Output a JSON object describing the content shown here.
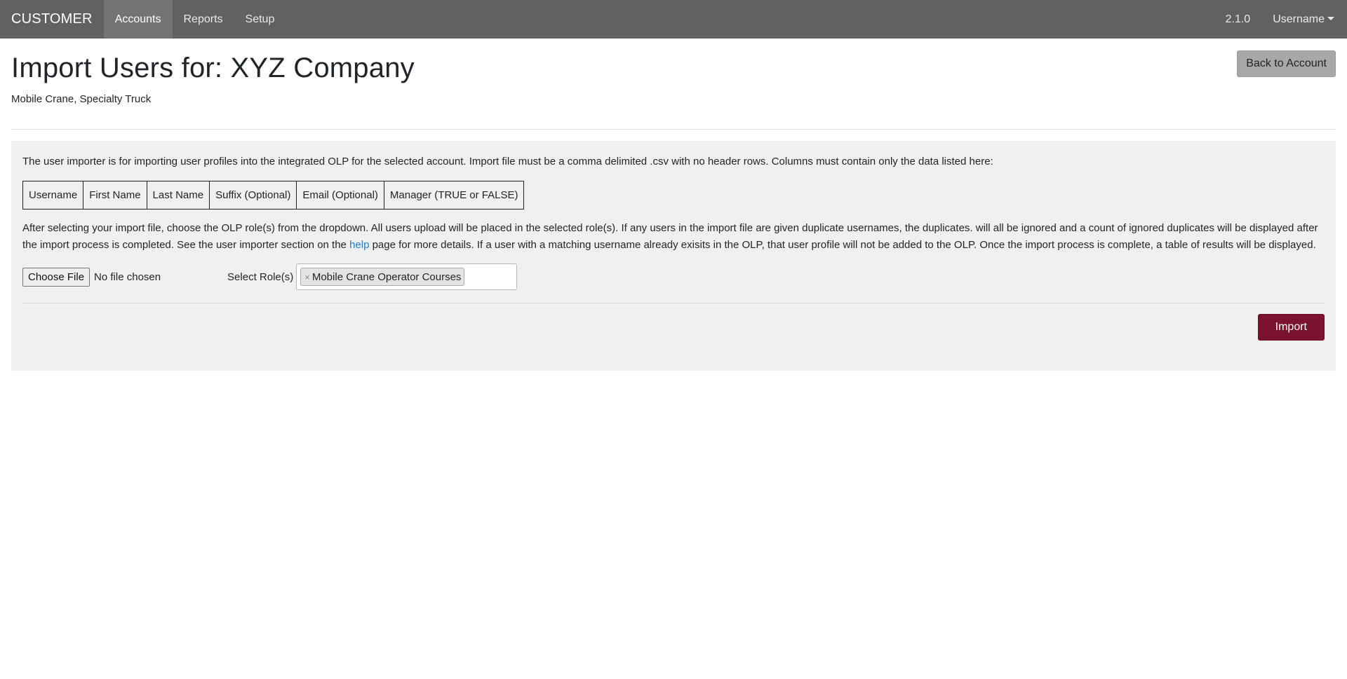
{
  "navbar": {
    "brand": "CUSTOMER",
    "items": [
      {
        "label": "Accounts",
        "active": true
      },
      {
        "label": "Reports",
        "active": false
      },
      {
        "label": "Setup",
        "active": false
      }
    ],
    "version": "2.1.0",
    "user": "Username"
  },
  "header": {
    "title": "Import Users for: XYZ Company",
    "subtitle": "Mobile Crane, Specialty Truck",
    "back_button": "Back to Account"
  },
  "panel": {
    "intro": "The user importer is for importing user profiles into the integrated OLP for the selected account. Import file must be a comma delimited .csv with no header rows. Columns must contain only the data listed here:",
    "columns": [
      "Username",
      "First Name",
      "Last Name",
      "Suffix (Optional)",
      "Email (Optional)",
      "Manager (TRUE or FALSE)"
    ],
    "details_before_link": "After selecting your import file, choose the OLP role(s) from the dropdown. All users upload will be placed in the selected role(s). If any users in the import file are given duplicate usernames, the duplicates. will all be ignored and a count of ignored duplicates will be displayed after the import process is completed. See the user importer section on the ",
    "details_link": "help",
    "details_after_link": " page for more details. If a user with a matching username already exisits in the OLP, that user profile will not be added to the OLP. Once the import process is complete, a table of results will be displayed.",
    "file_button": "Choose File",
    "file_status": "No file chosen",
    "role_label": "Select Role(s)",
    "selected_role": "Mobile Crane Operator Courses",
    "tag_remove": "×",
    "import_button": "Import"
  },
  "colors": {
    "navbar": "#606163",
    "import_button": "#7b1230",
    "link": "#1e7ad6"
  }
}
